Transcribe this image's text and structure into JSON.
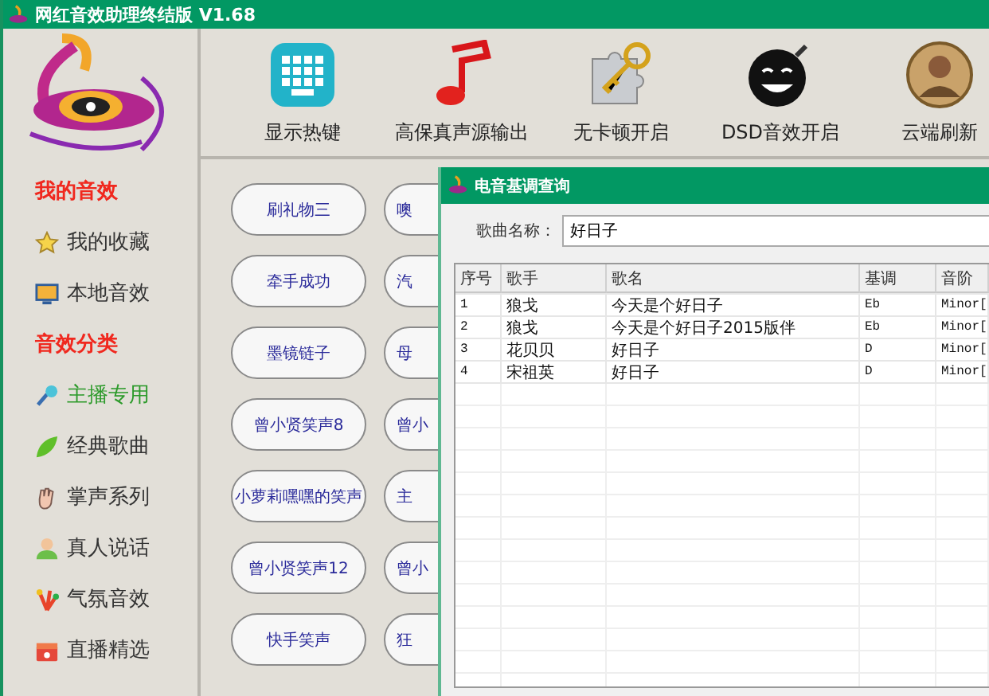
{
  "window": {
    "title": "网红音效助理终结版 V1.68"
  },
  "toolbar": [
    {
      "kind": "keyboard",
      "label": "显示热键"
    },
    {
      "kind": "note",
      "label": "高保真声源输出"
    },
    {
      "kind": "puzzle",
      "label": "无卡顿开启"
    },
    {
      "kind": "bomb",
      "label": "DSD音效开启"
    },
    {
      "kind": "avatar",
      "label": "云端刷新"
    }
  ],
  "sidebar": {
    "sections": [
      {
        "title": "我的音效",
        "items": [
          {
            "kind": "star",
            "label": "我的收藏",
            "selected": false
          },
          {
            "kind": "monitor",
            "label": "本地音效",
            "selected": false
          }
        ]
      },
      {
        "title": "音效分类",
        "items": [
          {
            "kind": "mic",
            "label": "主播专用",
            "selected": true
          },
          {
            "kind": "leaf",
            "label": "经典歌曲",
            "selected": false
          },
          {
            "kind": "hand",
            "label": "掌声系列",
            "selected": false
          },
          {
            "kind": "person",
            "label": "真人说话",
            "selected": false
          },
          {
            "kind": "fireworks",
            "label": "气氛音效",
            "selected": false
          },
          {
            "kind": "gift",
            "label": "直播精选",
            "selected": false
          }
        ]
      }
    ]
  },
  "sound_buttons": [
    [
      "刷礼物三",
      "噢"
    ],
    [
      "牵手成功",
      "汽"
    ],
    [
      "墨镜链子",
      "母"
    ],
    [
      "曾小贤笑声8",
      "曾小"
    ],
    [
      "小萝莉嘿嘿的笑声",
      "主"
    ],
    [
      "曾小贤笑声12",
      "曾小"
    ],
    [
      "快手笑声",
      "狂"
    ]
  ],
  "dialog": {
    "title": "电音基调查询",
    "field": {
      "label": "歌曲名称：",
      "value": "好日子"
    },
    "table": {
      "columns": [
        "序号",
        "歌手",
        "歌名",
        "基调",
        "音阶"
      ],
      "rows": [
        [
          "1",
          "狼戈",
          "今天是个好日子",
          "Eb",
          "Minor["
        ],
        [
          "2",
          "狼戈",
          "今天是个好日子2015版伴",
          "Eb",
          "Minor["
        ],
        [
          "3",
          "花贝贝",
          "好日子",
          "D",
          "Minor["
        ],
        [
          "4",
          "宋祖英",
          "好日子",
          "D",
          "Minor["
        ]
      ]
    }
  }
}
